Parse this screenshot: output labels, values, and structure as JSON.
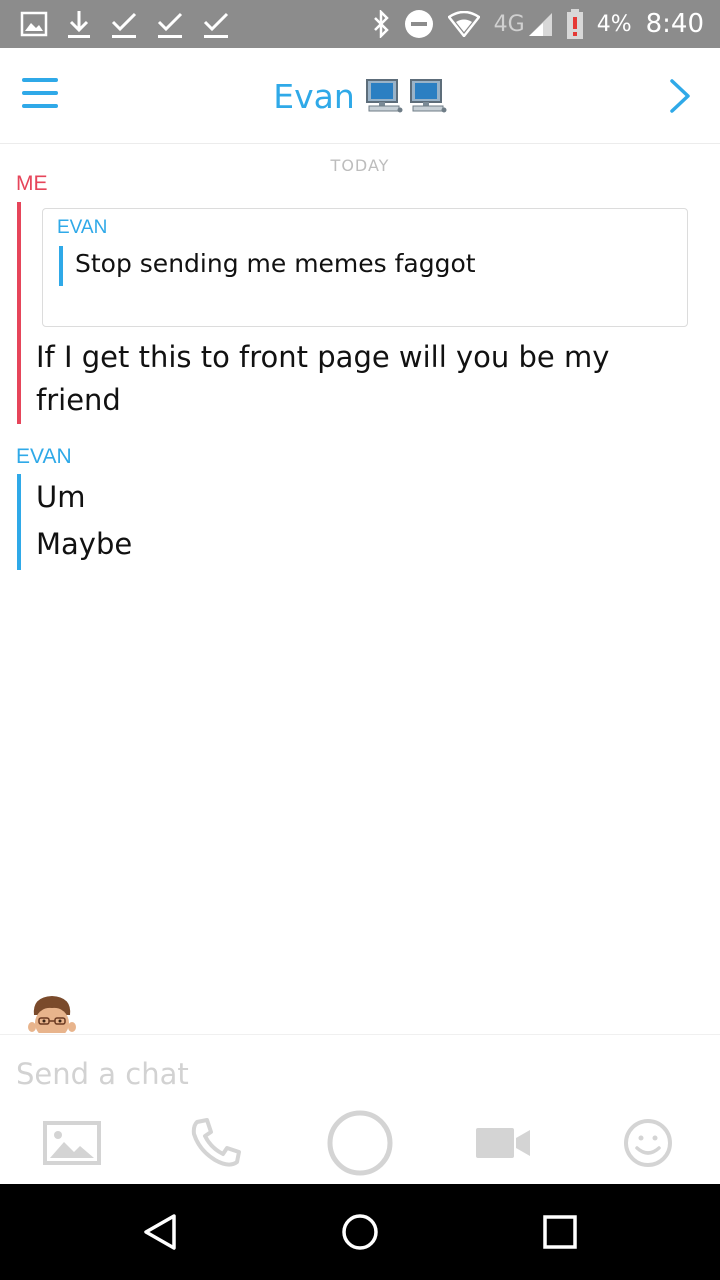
{
  "status_bar": {
    "signal_label": "4G",
    "battery": "4%",
    "time": "8:40",
    "alert": "!"
  },
  "header": {
    "title": "Evan",
    "title_emoji": "💻💻"
  },
  "chat": {
    "date_label": "TODAY",
    "groups": [
      {
        "sender": "ME",
        "sender_color": "#e6455a",
        "quote": {
          "sender": "EVAN",
          "text": "Stop sending me memes faggot"
        },
        "messages": [
          "If I get this to front page will you be my friend"
        ]
      },
      {
        "sender": "EVAN",
        "sender_color": "#2fa9e8",
        "messages": [
          "Um",
          "Maybe"
        ]
      }
    ]
  },
  "composer": {
    "placeholder": "Send a chat",
    "value": ""
  },
  "colors": {
    "accent_blue": "#2fa9e8",
    "me_red": "#e6455a",
    "status_bar_gray": "#8c8c8c",
    "tool_gray": "#d4d4d4"
  },
  "icons": {
    "status_left": [
      "image-notification-icon",
      "download-icon",
      "check-icon",
      "check-icon",
      "check-icon"
    ],
    "status_right": [
      "bluetooth-icon",
      "do-not-disturb-icon",
      "wifi-icon",
      "signal-icon",
      "battery-alert-icon"
    ],
    "header": [
      "menu-icon",
      "chevron-right-icon"
    ],
    "tools": [
      "photo-icon",
      "phone-icon",
      "capture-button-icon",
      "video-icon",
      "emoji-icon"
    ],
    "nav": [
      "back-icon",
      "home-icon",
      "recents-icon"
    ]
  }
}
